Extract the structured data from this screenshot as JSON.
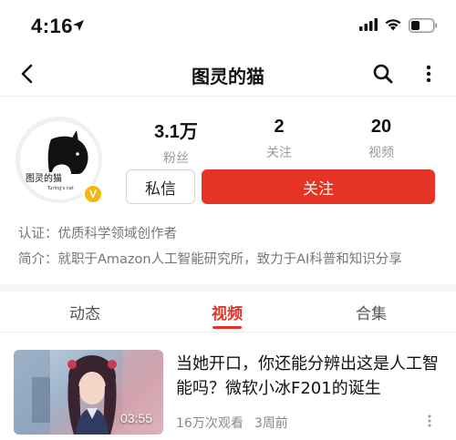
{
  "status_bar": {
    "time": "4:16"
  },
  "nav": {
    "title": "图灵的猫",
    "back_icon": "chevron-left-icon",
    "search_icon": "search-icon",
    "more_icon": "more-vertical-icon"
  },
  "profile": {
    "avatar_text": "图灵的猫",
    "avatar_subtext": "Turing's cat",
    "verified_badge": "V",
    "stats": [
      {
        "value": "3.1万",
        "label": "粉丝"
      },
      {
        "value": "2",
        "label": "关注"
      },
      {
        "value": "20",
        "label": "视频"
      }
    ],
    "message_button": "私信",
    "follow_button": "关注",
    "certification": "认证：优质科学领域创作者",
    "bio": "简介：就职于Amazon人工智能研究所，致力于AI科普和知识分享"
  },
  "tabs": [
    {
      "label": "动态"
    },
    {
      "label": "视频",
      "active": true
    },
    {
      "label": "合集"
    }
  ],
  "videos": [
    {
      "title": "当她开口，你还能分辨出这是人工智能吗？微软小冰F201的诞生",
      "duration": "03:55",
      "views": "16万次观看",
      "age": "3周前"
    }
  ],
  "colors": {
    "accent": "#e53326",
    "badge": "#f2b80f",
    "muted_text": "#999999"
  }
}
